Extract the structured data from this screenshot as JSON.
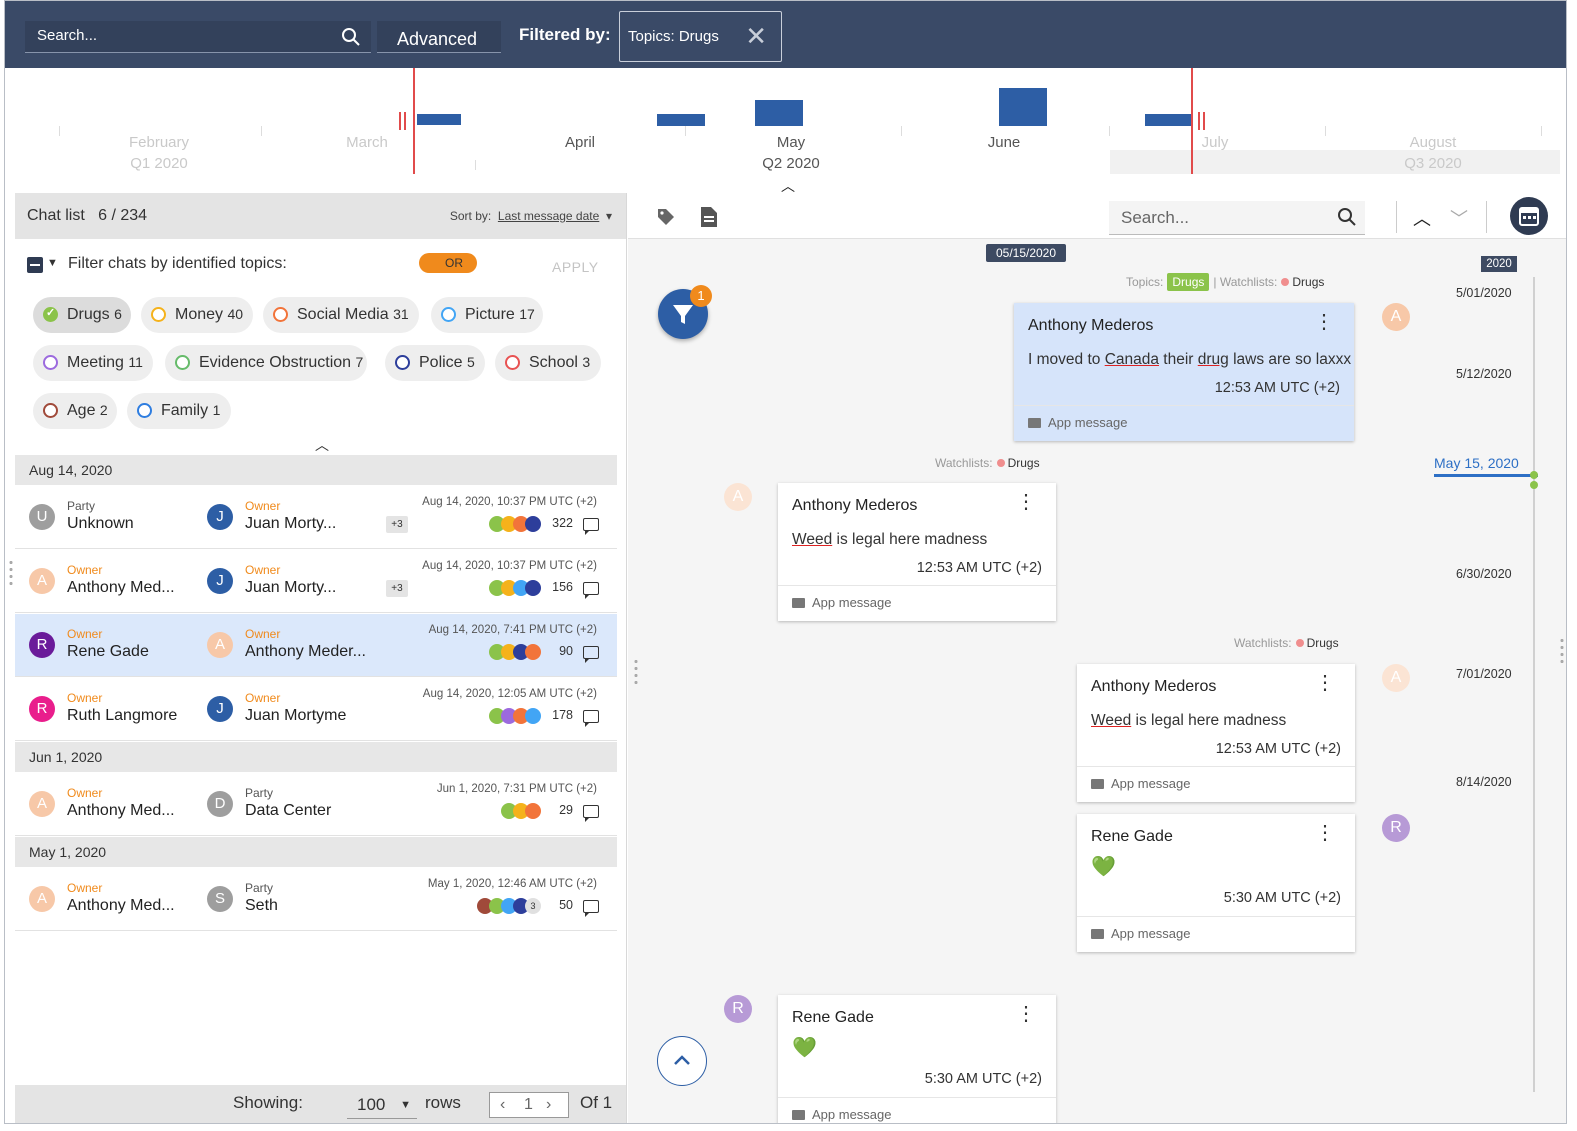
{
  "topbar": {
    "search_placeholder": "Search...",
    "advanced_label": "Advanced",
    "filtered_by_label": "Filtered by:",
    "filter_chip": "Topics:  Drugs"
  },
  "timeline": {
    "labels": [
      {
        "month": "February",
        "quarter": "Q1  2020"
      },
      {
        "month": "March"
      },
      {
        "month": "April"
      },
      {
        "month": "May",
        "quarter": "Q2  2020"
      },
      {
        "month": "June"
      },
      {
        "month": "July"
      },
      {
        "month": "August",
        "quarter": "Q3  2020"
      }
    ]
  },
  "chat_list": {
    "title": "Chat list",
    "count": "6 / 234",
    "sort_label": "Sort by:",
    "sort_value": "Last message date",
    "filter_label": "Filter chats by identified topics:",
    "toggle_label": "OR",
    "apply_label": "APPLY",
    "topics": [
      {
        "name": "Drugs",
        "count": "6",
        "color": "#8bc34a",
        "active": true
      },
      {
        "name": "Money",
        "count": "40",
        "color": "#f5b21b"
      },
      {
        "name": "Social Media",
        "count": "31",
        "color": "#f2743a"
      },
      {
        "name": "Picture",
        "count": "17",
        "color": "#42a5f5"
      },
      {
        "name": "Meeting",
        "count": "11",
        "color": "#9c6ade"
      },
      {
        "name": "Evidence Obstruction",
        "count": "7",
        "color": "#66bb6a"
      },
      {
        "name": "Police",
        "count": "5",
        "color": "#2d3e9b"
      },
      {
        "name": "School",
        "count": "3",
        "color": "#e85252"
      },
      {
        "name": "Age",
        "count": "2",
        "color": "#a04a3a"
      },
      {
        "name": "Family",
        "count": "1",
        "color": "#2e7de0"
      }
    ],
    "groups": [
      {
        "date": "Aug 14, 2020",
        "rows": [
          {
            "p1_role": "Party",
            "p1_name": "Unknown",
            "p1_initial": "U",
            "p1_color": "#9e9e9e",
            "p2_role": "Owner",
            "p2_name": "Juan Morty...",
            "p2_initial": "J",
            "p2_color": "#2d5ea5",
            "plus": "+3",
            "time": "Aug 14, 2020, 10:37 PM UTC (+2)",
            "messages": "322",
            "topic_colors": [
              "#8bc34a",
              "#f5b21b",
              "#f2743a",
              "#2d3e9b"
            ]
          },
          {
            "p1_role": "Owner",
            "p1_name": "Anthony Med...",
            "p1_initial": "A",
            "p1_color": "#f7c8a8",
            "p2_role": "Owner",
            "p2_name": "Juan Morty...",
            "p2_initial": "J",
            "p2_color": "#2d5ea5",
            "plus": "+3",
            "time": "Aug 14, 2020, 10:37 PM UTC (+2)",
            "messages": "156",
            "topic_colors": [
              "#8bc34a",
              "#f5b21b",
              "#42a5f5",
              "#2d3e9b"
            ]
          },
          {
            "p1_role": "Owner",
            "p1_name": "Rene Gade",
            "p1_initial": "R",
            "p1_color": "#6a1b9a",
            "p2_role": "Owner",
            "p2_name": "Anthony Meder...",
            "p2_initial": "A",
            "p2_color": "#f7c8a8",
            "plus": "",
            "time": "Aug 14, 2020, 7:41 PM UTC (+2)",
            "messages": "90",
            "topic_colors": [
              "#8bc34a",
              "#f5b21b",
              "#2d3e9b",
              "#f2743a"
            ],
            "selected": true
          },
          {
            "p1_role": "Owner",
            "p1_name": "Ruth Langmore",
            "p1_initial": "R",
            "p1_color": "#e91e8c",
            "p2_role": "Owner",
            "p2_name": "Juan Mortyme",
            "p2_initial": "J",
            "p2_color": "#2d5ea5",
            "plus": "",
            "time": "Aug 14, 2020, 12:05 AM UTC (+2)",
            "messages": "178",
            "topic_colors": [
              "#8bc34a",
              "#9c6ade",
              "#f2743a",
              "#42a5f5"
            ]
          }
        ]
      },
      {
        "date": "Jun 1, 2020",
        "rows": [
          {
            "p1_role": "Owner",
            "p1_name": "Anthony Med...",
            "p1_initial": "A",
            "p1_color": "#f7c8a8",
            "p2_role": "Party",
            "p2_name": "Data Center",
            "p2_initial": "D",
            "p2_color": "#9e9e9e",
            "plus": "",
            "time": "Jun 1, 2020, 7:31 PM UTC (+2)",
            "messages": "29",
            "topic_colors": [
              "#8bc34a",
              "#f5b21b",
              "#f2743a"
            ]
          }
        ]
      },
      {
        "date": "May 1, 2020",
        "rows": [
          {
            "p1_role": "Owner",
            "p1_name": "Anthony Med...",
            "p1_initial": "A",
            "p1_color": "#f7c8a8",
            "p2_role": "Party",
            "p2_name": "Seth",
            "p2_initial": "S",
            "p2_color": "#9e9e9e",
            "plus": "",
            "time": "May 1, 2020, 12:46 AM UTC (+2)",
            "messages": "50",
            "topic_colors": [
              "#a04a3a",
              "#8bc34a",
              "#42a5f5",
              "#2d3e9b"
            ],
            "more": "3"
          }
        ]
      }
    ],
    "footer": {
      "showing": "Showing:",
      "rows_value": "100",
      "rows_label": "rows",
      "page": "1",
      "of": "Of 1"
    }
  },
  "conversation": {
    "search_placeholder": "Search...",
    "date_pill": "05/15/2020",
    "filter_badge": "1",
    "topics_label": "Topics:",
    "watchlists_label": "Watchlists:",
    "watchlist_name": "Drugs",
    "topic_tag": "Drugs",
    "app_message": "App message",
    "messages": [
      {
        "sender": "Anthony Mederos",
        "pre": "I moved to ",
        "w1": "Canada",
        "mid": " their ",
        "w2": "drug",
        "post": " laws are so laxxx",
        "time": "12:53 AM UTC (+2)",
        "avatar": "A"
      },
      {
        "sender": "Anthony Mederos",
        "w1": "Weed",
        "post": " is legal here madness",
        "time": "12:53 AM UTC (+2)",
        "avatar": "A"
      },
      {
        "sender": "Anthony Mederos",
        "w1": "Weed",
        "post": " is legal here madness",
        "time": "12:53 AM UTC (+2)",
        "avatar": "A"
      },
      {
        "sender": "Rene Gade",
        "body": "💚",
        "time": "5:30 AM UTC (+2)",
        "avatar": "R"
      },
      {
        "sender": "Rene Gade",
        "body": "💚",
        "time": "5:30 AM UTC (+2)",
        "avatar": "R"
      }
    ],
    "rail": {
      "year": "2020",
      "dates": [
        "5/01/2020",
        "5/12/2020",
        "6/30/2020",
        "7/01/2020",
        "8/14/2020"
      ],
      "active": "May 15, 2020"
    }
  }
}
